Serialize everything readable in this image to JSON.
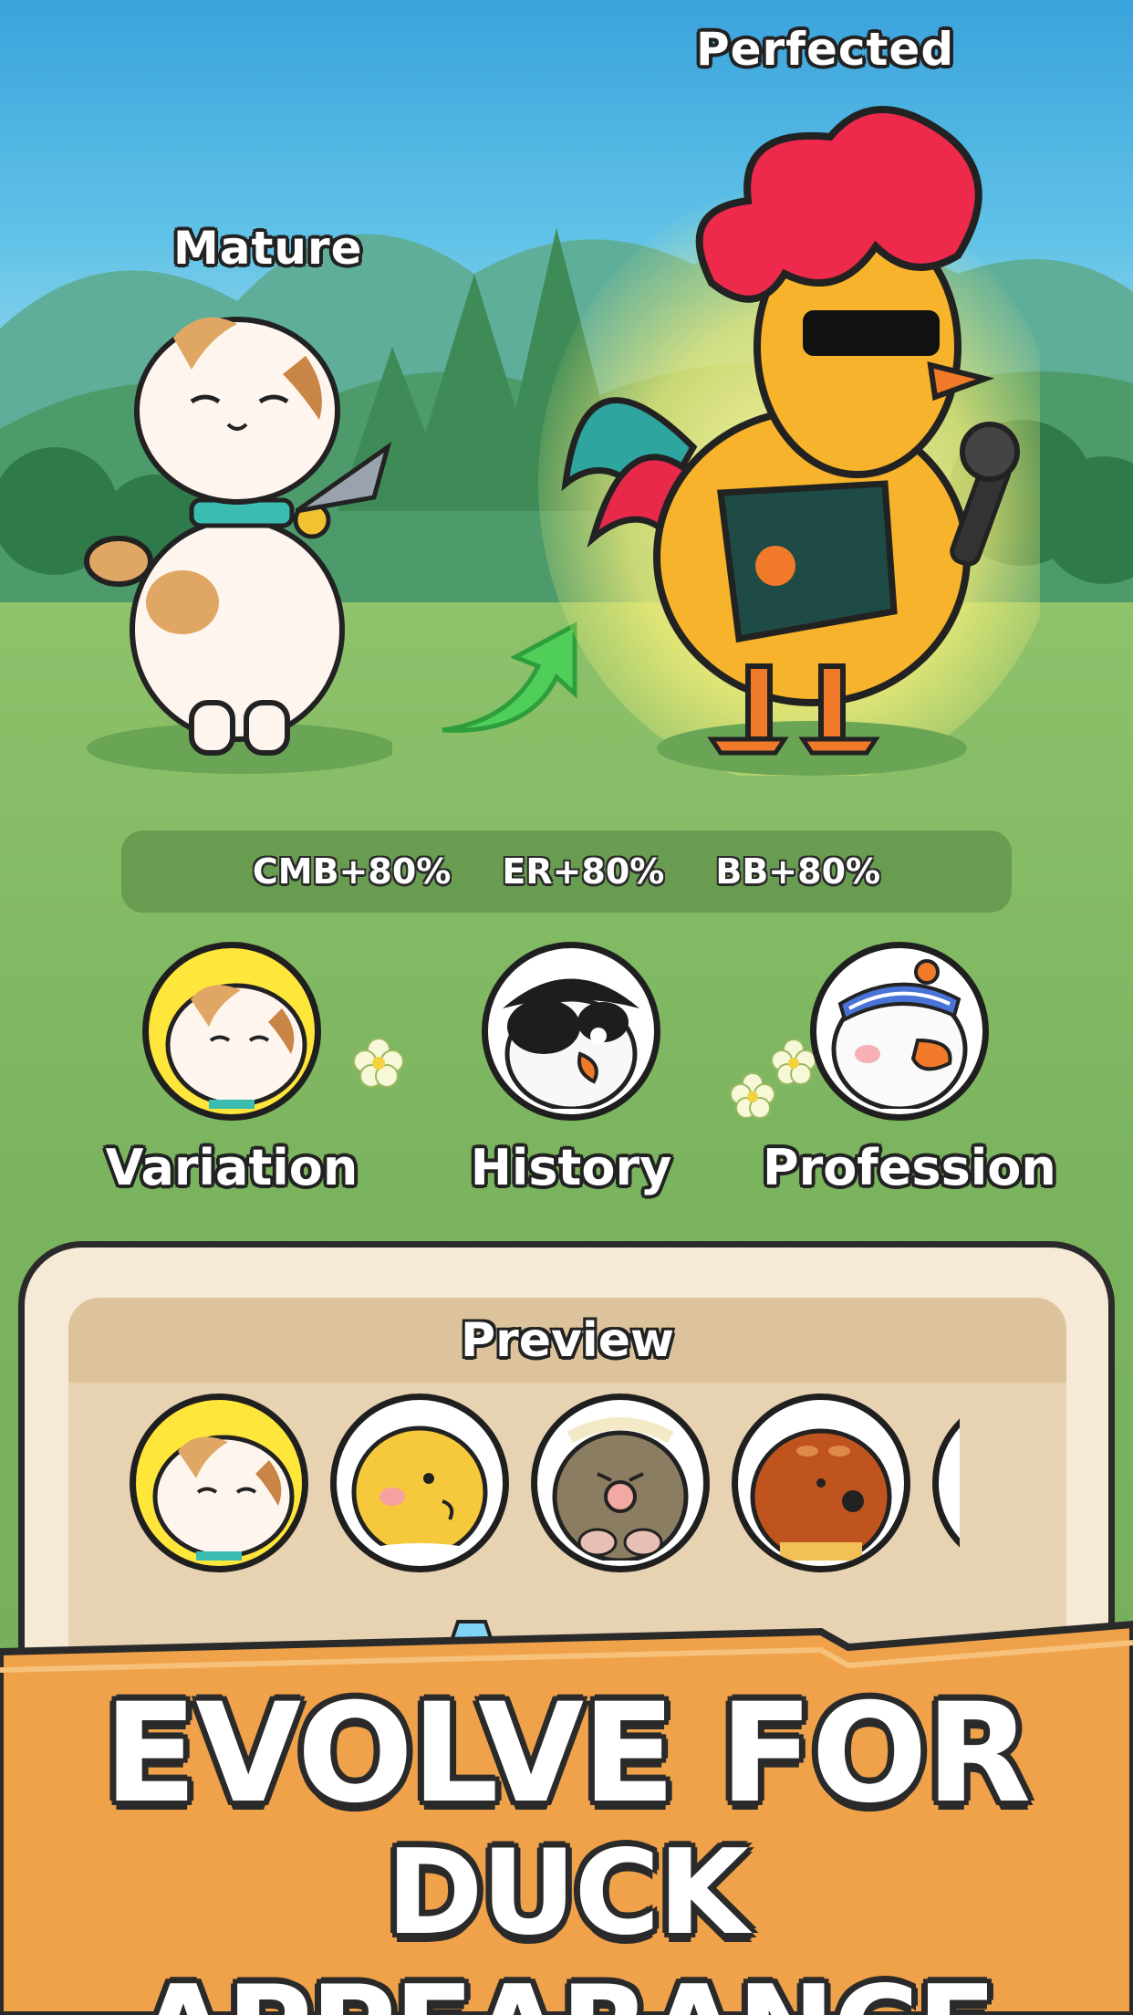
{
  "stages": {
    "current": "Mature",
    "next": "Perfected"
  },
  "stats": [
    {
      "label": "CMB+80%"
    },
    {
      "label": "ER+80%"
    },
    {
      "label": "BB+80%"
    }
  ],
  "options": [
    {
      "label": "Variation",
      "icon": "cat-avatar-icon",
      "selected": true
    },
    {
      "label": "History",
      "icon": "pirate-duck-avatar-icon",
      "selected": false
    },
    {
      "label": "Profession",
      "icon": "headband-duck-avatar-icon",
      "selected": false
    }
  ],
  "preview": {
    "title": "Preview",
    "items": [
      {
        "icon": "cat-avatar-icon",
        "selected": true
      },
      {
        "icon": "chick-avatar-icon",
        "selected": false
      },
      {
        "icon": "mole-avatar-icon",
        "selected": false
      },
      {
        "icon": "dog-avatar-icon",
        "selected": false
      },
      {
        "icon": "partial-avatar-icon",
        "selected": false
      }
    ]
  },
  "headline": {
    "line1": "EVOLVE FOR",
    "line2": "DUCK APPEARANCE"
  },
  "colors": {
    "banner": "#f0a24a",
    "panel": "#f6ead6",
    "rooster_comb": "#ee2a4c",
    "selected_ring": "#ffe63a"
  }
}
